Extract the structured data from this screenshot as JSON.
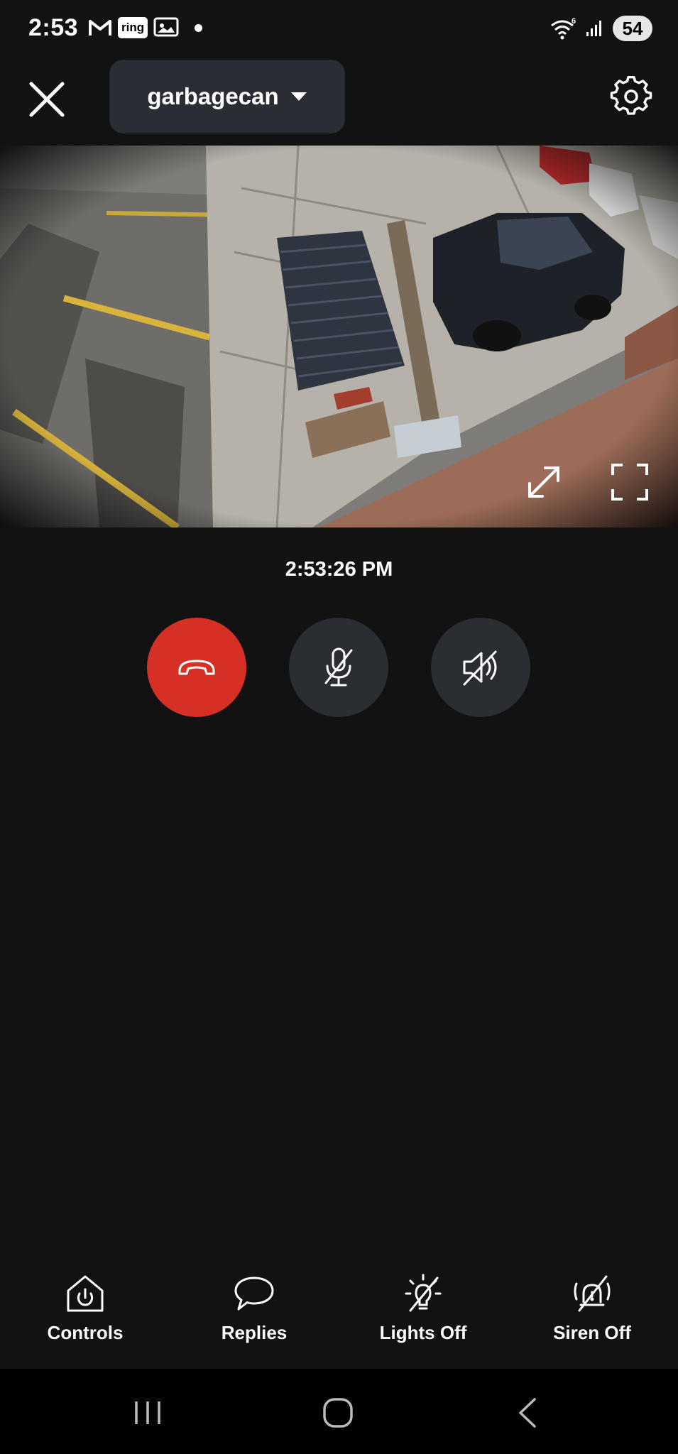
{
  "status_bar": {
    "time": "2:53",
    "ring_badge": "ring",
    "battery": "54",
    "icons": [
      "gmail-icon",
      "ring-icon",
      "image-icon",
      "notification-dot",
      "wifi-6-icon",
      "signal-icon",
      "battery-icon"
    ]
  },
  "header": {
    "device_name": "garbagecan",
    "close_icon": "close-icon",
    "dropdown_icon": "caret-down-icon",
    "settings_icon": "gear-icon"
  },
  "video": {
    "expand_icon": "expand-icon",
    "fullscreen_icon": "fullscreen-icon"
  },
  "timestamp": "2:53:26 PM",
  "call_controls": {
    "hangup_icon": "hang-up-icon",
    "mic_icon": "microphone-muted-icon",
    "speaker_icon": "speaker-muted-icon",
    "hangup_color": "#d62f26",
    "button_color": "#2a2d31"
  },
  "actions": [
    {
      "label": "Controls",
      "icon": "home-power-icon"
    },
    {
      "label": "Replies",
      "icon": "speech-bubble-icon"
    },
    {
      "label": "Lights Off",
      "icon": "light-off-icon"
    },
    {
      "label": "Siren Off",
      "icon": "siren-off-icon"
    }
  ],
  "nav_bar": {
    "icons": [
      "recent-apps-icon",
      "home-icon",
      "back-icon"
    ]
  }
}
